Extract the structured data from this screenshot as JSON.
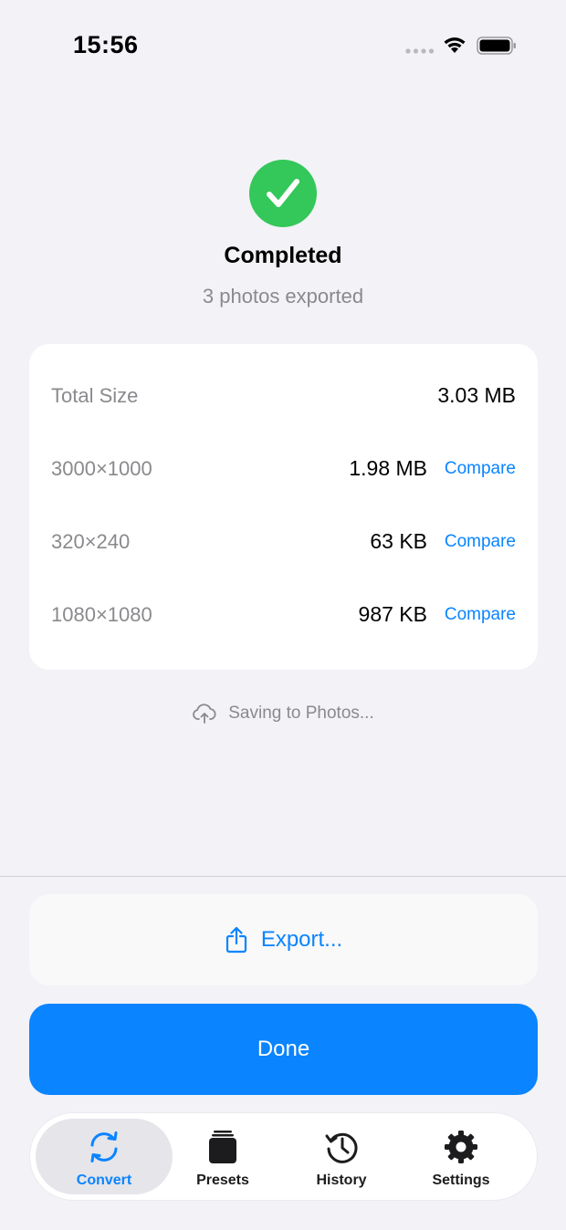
{
  "status_bar": {
    "time": "15:56",
    "icons": [
      "signal-dots-icon",
      "wifi-icon",
      "battery-icon"
    ]
  },
  "completion": {
    "icon": "checkmark-circle-icon",
    "title": "Completed",
    "subtitle": "3 photos exported"
  },
  "summary": {
    "total_label": "Total Size",
    "total_value": "3.03 MB",
    "items": [
      {
        "label": "3000×1000",
        "size": "1.98 MB",
        "action": "Compare"
      },
      {
        "label": "320×240",
        "size": "63 KB",
        "action": "Compare"
      },
      {
        "label": "1080×1080",
        "size": "987 KB",
        "action": "Compare"
      }
    ]
  },
  "saving": {
    "icon": "cloud-upload-icon",
    "text": "Saving to Photos..."
  },
  "actions": {
    "export_label": "Export...",
    "export_icon": "share-icon",
    "done_label": "Done"
  },
  "tab_bar": {
    "tabs": [
      {
        "label": "Convert",
        "icon": "convert-icon",
        "active": true
      },
      {
        "label": "Presets",
        "icon": "presets-icon",
        "active": false
      },
      {
        "label": "History",
        "icon": "history-icon",
        "active": false
      },
      {
        "label": "Settings",
        "icon": "settings-icon",
        "active": false
      }
    ]
  },
  "colors": {
    "background": "#f2f2f7",
    "accent": "#0a84ff",
    "success": "#34c759",
    "secondary_text": "#8a8a8e"
  }
}
